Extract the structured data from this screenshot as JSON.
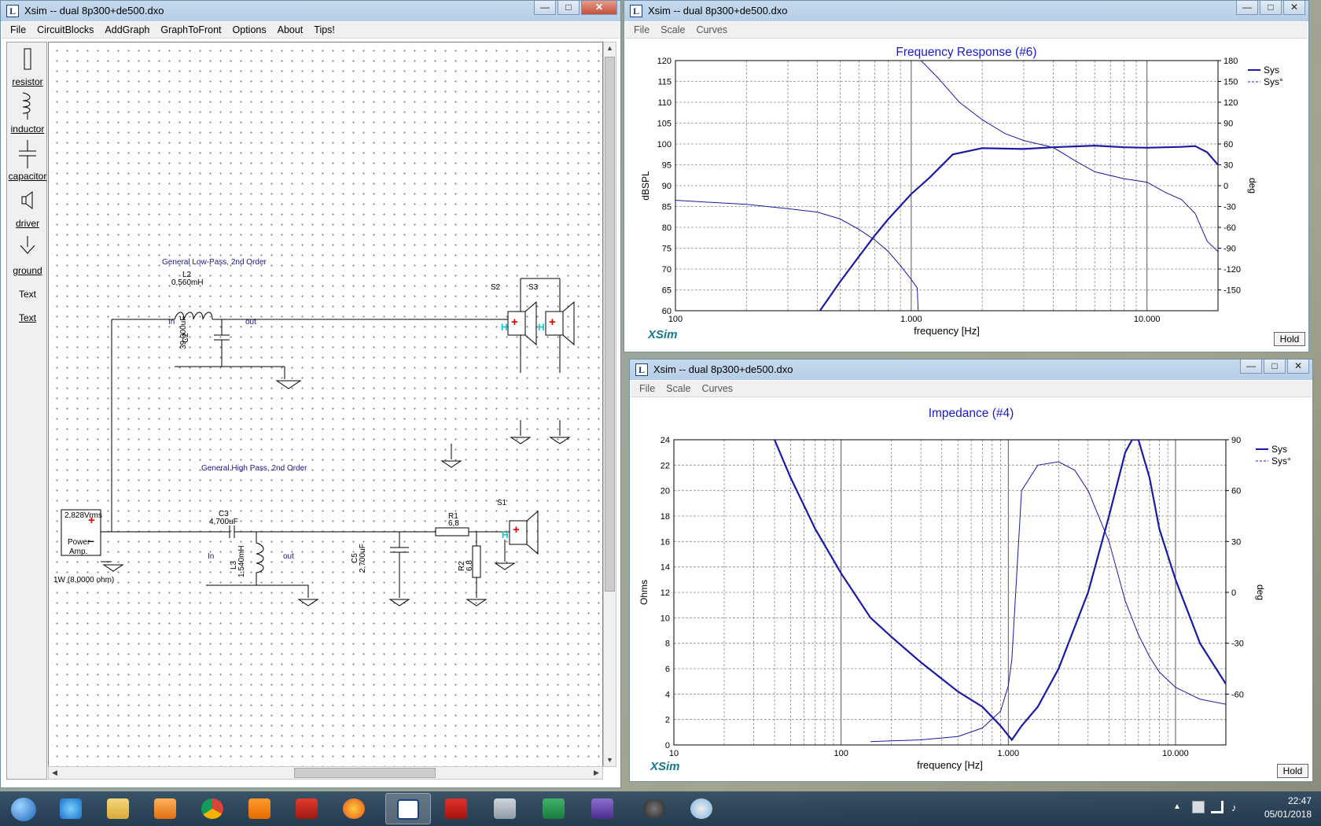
{
  "circuit_window": {
    "title": "Xsim -- dual 8p300+de500.dxo",
    "menu": [
      "File",
      "CircuitBlocks",
      "AddGraph",
      "GraphToFront",
      "Options",
      "About",
      "Tips!"
    ],
    "tools": [
      "resistor",
      "inductor",
      "capacitor",
      "driver",
      "ground",
      "Text",
      "Text"
    ],
    "schematic": {
      "lowpass_title": "General Low-Pass, 2nd Order",
      "l2_name": "L2",
      "l2_value": "0,560mH",
      "c2_name": "C2",
      "c2_value": "39,000uF",
      "lp_in": "In",
      "lp_out": "out",
      "s2": "S2",
      "s3": "S3",
      "s1": "S1",
      "highpass_title": "General High Pass, 2nd Order",
      "c3_name": "C3",
      "c3_value": "4,700uF",
      "l3_name": "L3",
      "l3_value": "1,540mH",
      "hp_in": "In",
      "hp_out": "out",
      "c5_name": "C5",
      "c5_value": "2,700uF",
      "r1_name": "R1",
      "r1_value": "6,8",
      "r2_name": "R2",
      "r2_value": "6,8",
      "amp_voltage": "2,828Vrms",
      "amp_label_1": "Power",
      "amp_label_2": "Amp.",
      "amp_power": "1W (8,0000 ohm)"
    }
  },
  "freq_window": {
    "title": "Xsim -- dual 8p300+de500.dxo",
    "menu": [
      "File",
      "Scale",
      "Curves"
    ],
    "graph_title": "Frequency Response (#6)",
    "ylabel": "dBSPL",
    "y2label": "deg",
    "xlabel": "frequency [Hz]",
    "legend": [
      "Sys",
      "Sys°"
    ],
    "brand": "XSim",
    "hold": "Hold"
  },
  "imp_window": {
    "title": "Xsim -- dual 8p300+de500.dxo",
    "menu": [
      "File",
      "Scale",
      "Curves"
    ],
    "graph_title": "Impedance (#4)",
    "ylabel": "Ohms",
    "y2label": "deg",
    "xlabel": "frequency [Hz]",
    "legend": [
      "Sys",
      "Sys°"
    ],
    "brand": "XSim",
    "hold": "Hold"
  },
  "chart_data": [
    {
      "type": "line",
      "title": "Frequency Response (#6)",
      "xlabel": "frequency [Hz]",
      "ylabel": "dBSPL",
      "y2label": "deg",
      "xscale": "log",
      "xlim": [
        100,
        20000
      ],
      "ylim": [
        60,
        120
      ],
      "y2lim": [
        -180,
        180
      ],
      "x_ticks": [
        "100",
        "1.000",
        "10.000"
      ],
      "y_ticks": [
        "60",
        "65",
        "70",
        "75",
        "80",
        "85",
        "90",
        "95",
        "100",
        "105",
        "110",
        "115",
        "120"
      ],
      "y2_ticks": [
        "-150",
        "-120",
        "-90",
        "-60",
        "-30",
        "0",
        "30",
        "60",
        "90",
        "120",
        "150",
        "180"
      ],
      "grid": true,
      "legend_position": "top-right",
      "series": [
        {
          "name": "Sys",
          "axis": "left",
          "style": "solid",
          "x": [
            410,
            500,
            600,
            700,
            800,
            1000,
            1200,
            1500,
            2000,
            3000,
            4000,
            6000,
            8000,
            10000,
            14000,
            16000,
            18000,
            20000
          ],
          "y": [
            60,
            67,
            73,
            78,
            82,
            88,
            92,
            97.5,
            99,
            98.8,
            99.2,
            99.6,
            99.2,
            99.1,
            99.3,
            99.5,
            98,
            95
          ]
        },
        {
          "name": "Sys°",
          "axis": "right",
          "style": "dashed",
          "x": [
            100,
            200,
            300,
            400,
            500,
            600,
            700,
            800,
            900,
            1000,
            1060,
            1070,
            1100,
            1300,
            1600,
            2000,
            2500,
            3000,
            4000,
            5000,
            6000,
            8000,
            10000,
            12000,
            14000,
            16000,
            18000,
            20000
          ],
          "y": [
            -21,
            -27,
            -33,
            -38,
            -48,
            -63,
            -78,
            -95,
            -115,
            -135,
            -147,
            -180,
            180,
            155,
            120,
            95,
            75,
            65,
            55,
            35,
            20,
            10,
            5,
            -10,
            -20,
            -40,
            -80,
            -95
          ]
        }
      ]
    },
    {
      "type": "line",
      "title": "Impedance (#4)",
      "xlabel": "frequency [Hz]",
      "ylabel": "Ohms",
      "y2label": "deg",
      "xscale": "log",
      "xlim": [
        10,
        20000
      ],
      "ylim": [
        0,
        24
      ],
      "y2lim": [
        -90,
        90
      ],
      "x_ticks": [
        "10",
        "100",
        "1.000",
        "10.000"
      ],
      "y_ticks": [
        "0",
        "2",
        "4",
        "6",
        "8",
        "10",
        "12",
        "14",
        "16",
        "18",
        "20",
        "22",
        "24"
      ],
      "y2_ticks": [
        "-60",
        "-30",
        "0",
        "30",
        "60",
        "90"
      ],
      "grid": true,
      "legend_position": "top-right",
      "series": [
        {
          "name": "Sys",
          "axis": "left",
          "style": "solid",
          "x": [
            40,
            50,
            70,
            100,
            150,
            200,
            300,
            500,
            700,
            900,
            1050,
            1200,
            1500,
            2000,
            3000,
            4000,
            5000,
            5500,
            6000,
            7000,
            8000,
            10000,
            14000,
            20000
          ],
          "y": [
            24,
            21,
            17,
            13.5,
            10,
            8.5,
            6.5,
            4.2,
            3,
            1.5,
            0.4,
            1.5,
            3,
            6,
            12,
            18,
            23,
            24,
            24,
            21,
            17,
            13,
            8,
            4.8
          ]
        },
        {
          "name": "Sys°",
          "axis": "right",
          "style": "thin",
          "x": [
            150,
            300,
            500,
            700,
            900,
            1000,
            1050,
            1100,
            1200,
            1500,
            2000,
            2500,
            3000,
            4000,
            5000,
            6000,
            7000,
            8000,
            10000,
            14000,
            20000
          ],
          "y": [
            -88,
            -87,
            -85,
            -80,
            -70,
            -55,
            -40,
            -5,
            60,
            75,
            77,
            72,
            60,
            30,
            -5,
            -25,
            -38,
            -47,
            -56,
            -63,
            -66
          ]
        }
      ]
    }
  ],
  "taskbar": {
    "time": "22:47",
    "date": "05/01/2018"
  }
}
